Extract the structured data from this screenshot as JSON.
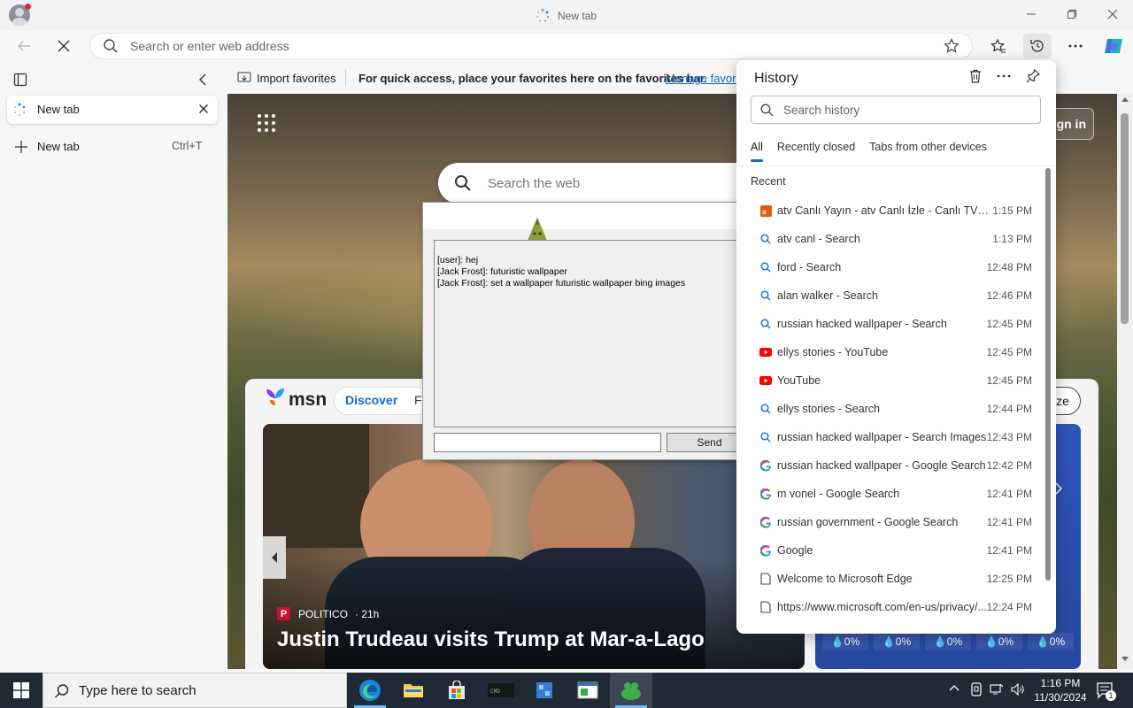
{
  "browser": {
    "tab_title": "New tab",
    "address_placeholder": "Search or enter web address"
  },
  "sidebar": {
    "tab_label": "New tab",
    "new_tab_label": "New tab",
    "new_tab_shortcut": "Ctrl+T"
  },
  "favorites_bar": {
    "import_label": "Import favorites",
    "hint": "For quick access, place your favorites here on the favorites bar.",
    "manage_link": "Manage favori"
  },
  "page": {
    "search_placeholder": "Search the web",
    "signin": "gn in",
    "msn_logo": "msn",
    "msn_tab_discover": "Discover",
    "msn_tab_partial": "Fo",
    "personalize_partial": "ize",
    "news_source": "POLITICO",
    "news_age": "· 21h",
    "news_headline": "Justin Trudeau visits Trump at Mar-a-Lago",
    "weather_values": [
      "0%",
      "0%",
      "0%",
      "0%",
      "0%"
    ]
  },
  "chat_window": {
    "messages": [
      "[user]: hej",
      "[Jack Frost]: futuristic wallpaper",
      "[Jack Frost]: set a wallpaper futuristic wallpaper bing images"
    ],
    "input_value": "",
    "send_label": "Send"
  },
  "history": {
    "title": "History",
    "search_placeholder": "Search history",
    "tabs": [
      "All",
      "Recently closed",
      "Tabs from other devices"
    ],
    "active_tab": "All",
    "section_label": "Recent",
    "items": [
      {
        "title": "atv Canlı Yayın - atv Canlı İzle - Canlı TV İzle...",
        "time": "1:15 PM",
        "icon": "atv-favicon"
      },
      {
        "title": "atv canl - Search",
        "time": "1:13 PM",
        "icon": "bing-search-icon"
      },
      {
        "title": "ford - Search",
        "time": "12:48 PM",
        "icon": "bing-search-icon"
      },
      {
        "title": "alan walker - Search",
        "time": "12:46 PM",
        "icon": "bing-search-icon"
      },
      {
        "title": "russian hacked wallpaper - Search",
        "time": "12:45 PM",
        "icon": "bing-search-icon"
      },
      {
        "title": "ellys stories - YouTube",
        "time": "12:45 PM",
        "icon": "youtube-icon"
      },
      {
        "title": "YouTube",
        "time": "12:45 PM",
        "icon": "youtube-icon"
      },
      {
        "title": "ellys stories - Search",
        "time": "12:44 PM",
        "icon": "bing-search-icon"
      },
      {
        "title": "russian hacked wallpaper - Search Images",
        "time": "12:43 PM",
        "icon": "bing-search-icon"
      },
      {
        "title": "russian hacked wallpaper - Google Search",
        "time": "12:42 PM",
        "icon": "google-icon"
      },
      {
        "title": "m vonel - Google Search",
        "time": "12:41 PM",
        "icon": "google-icon"
      },
      {
        "title": "russian government - Google Search",
        "time": "12:41 PM",
        "icon": "google-icon"
      },
      {
        "title": "Google",
        "time": "12:41 PM",
        "icon": "google-icon"
      },
      {
        "title": "Welcome to Microsoft Edge",
        "time": "12:25 PM",
        "icon": "page-icon"
      },
      {
        "title": "https://www.microsoft.com/en-us/privacy/...",
        "time": "12:24 PM",
        "icon": "page-icon"
      }
    ]
  },
  "taskbar": {
    "search_placeholder": "Type here to search",
    "time": "1:16 PM",
    "date": "11/30/2024",
    "notification_count": "1"
  },
  "colors": {
    "accent": "#0f6cbd",
    "taskbar": "#1f2a36",
    "youtube": "#ff0000",
    "bing": "#1a73e8"
  }
}
